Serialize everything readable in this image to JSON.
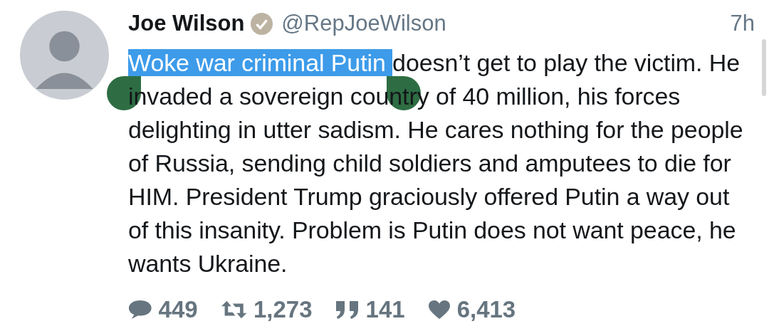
{
  "author": {
    "name": "Joe Wilson",
    "verified": true,
    "handle": "@RepJoeWilson"
  },
  "time": "7h",
  "body": [
    {
      "text": "Woke war criminal Putin ",
      "selected": true
    },
    {
      "text": "doesn’t get to play the victim. He invaded a sovereign country of 40 million, his forces delighting in utter sadism. He cares nothing for the people of Russia, sending child soldiers and amputees to die for HIM. President Trump graciously offered Putin a way out of this insanity. Problem is Putin does not want peace, he wants Ukraine.",
      "selected": false
    }
  ],
  "actions": [
    {
      "kind": "reply",
      "count": "449"
    },
    {
      "kind": "retweet",
      "count": "1,273"
    },
    {
      "kind": "quote",
      "count": "141"
    },
    {
      "kind": "like",
      "count": "6,413"
    }
  ]
}
